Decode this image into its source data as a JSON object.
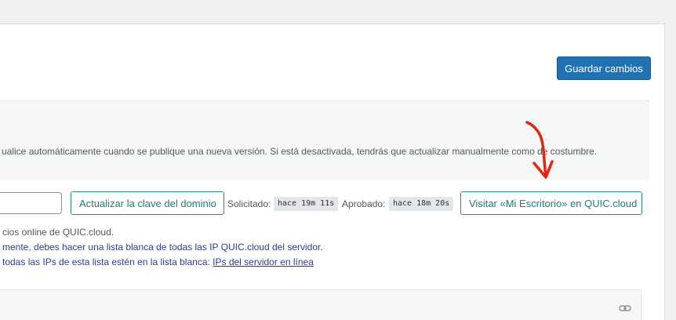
{
  "toolbar": {
    "save_label": "Guardar cambios"
  },
  "notice": {
    "text": "ualice automáticamente cuando se publique una nueva versión. Si está desactivada, tendrás que actualizar manualmente como de costumbre."
  },
  "domain_key": {
    "input_value": "",
    "update_button": "Actualizar la clave del dominio",
    "requested_label": "Solicitado:",
    "requested_value": "hace 19m 11s",
    "approved_label": "Aprobado:",
    "approved_value": "hace 18m 20s",
    "visit_button": "Visitar «Mi Escritorio» en QUIC.cloud"
  },
  "description": {
    "line1": "cios online de QUIC.cloud.",
    "line2": "mente, debes hacer una lista blanca de todas las IP QUIC.cloud del servidor.",
    "line3_prefix": "todas las IPs de esta lista estén en la lista blanca: ",
    "line3_link": "IPs del servidor en línea"
  },
  "icons": {
    "link": "link-icon",
    "arrow": "annotation-arrow"
  },
  "colors": {
    "primary": "#2271b1",
    "teal": "#2c8d8b",
    "arrow": "#e8230d"
  }
}
